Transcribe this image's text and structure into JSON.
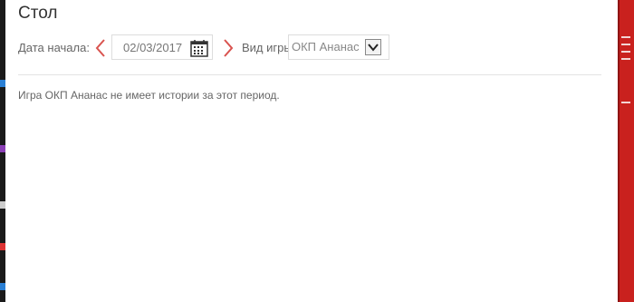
{
  "dialog": {
    "title": "Стол"
  },
  "filters": {
    "start_date_label": "Дата начала:",
    "start_date_value": "02/03/2017",
    "game_type_label": "Вид игры:",
    "game_type_value": "ОКП Ананас"
  },
  "message": "Игра ОКП Ананас не имеет истории за этот период.",
  "icons": {
    "prev": "chevron-left-icon",
    "next": "chevron-right-icon",
    "calendar": "calendar-icon",
    "dropdown": "chevron-down-icon"
  },
  "colors": {
    "accent_red": "#d9534f",
    "right_strip": "#c9211e",
    "left_strip": "#1a1a1a"
  }
}
